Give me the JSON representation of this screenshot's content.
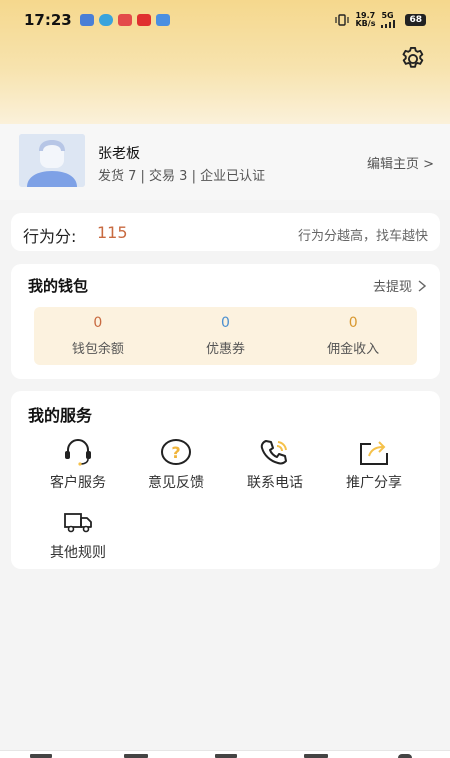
{
  "status_bar": {
    "time": "17:23",
    "net_speed": "19.7",
    "net_unit": "KB/s",
    "network": "5G",
    "battery": "68"
  },
  "profile": {
    "name": "张老板",
    "stats": "发货 7 | 交易 3  | 企业已认证",
    "edit_link": "编辑主页 >"
  },
  "score": {
    "label": "行为分:",
    "value": "115",
    "tip": "行为分越高，找车越快"
  },
  "wallet": {
    "title": "我的钱包",
    "withdraw": "去提现",
    "items": [
      {
        "value": "0",
        "label": "钱包余额",
        "color": "#c86a40"
      },
      {
        "value": "0",
        "label": "优惠券",
        "color": "#4a8fd0"
      },
      {
        "value": "0",
        "label": "佣金收入",
        "color": "#d8982f"
      }
    ]
  },
  "services": {
    "title": "我的服务",
    "items": [
      {
        "label": "客户服务",
        "icon": "headset-icon"
      },
      {
        "label": "意见反馈",
        "icon": "question-icon"
      },
      {
        "label": "联系电话",
        "icon": "phone-icon"
      },
      {
        "label": "推广分享",
        "icon": "share-icon"
      },
      {
        "label": "其他规则",
        "icon": "truck-icon"
      }
    ]
  },
  "colors": {
    "accent": "#f5c14a",
    "score_value": "#c86a40",
    "header_gradient_top": "#f5d88d"
  }
}
